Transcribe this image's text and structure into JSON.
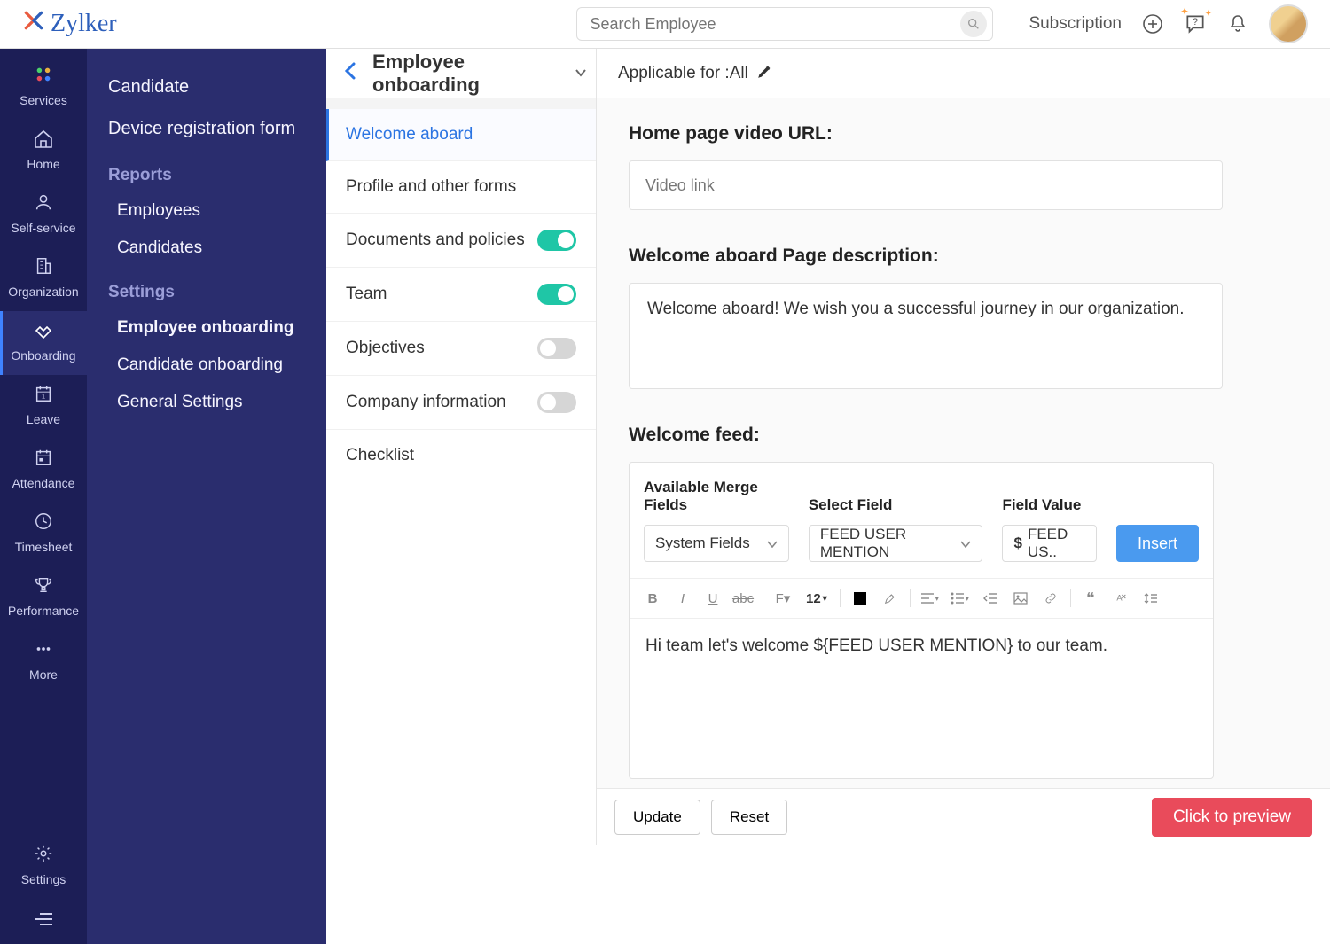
{
  "brand": {
    "name": "Zylker"
  },
  "header": {
    "search_placeholder": "Search Employee",
    "subscription": "Subscription"
  },
  "rail": {
    "items": [
      {
        "label": "Services",
        "icon": "grid"
      },
      {
        "label": "Home",
        "icon": "home"
      },
      {
        "label": "Self-service",
        "icon": "person"
      },
      {
        "label": "Organization",
        "icon": "building"
      },
      {
        "label": "Onboarding",
        "icon": "handshake",
        "active": true
      },
      {
        "label": "Leave",
        "icon": "calendar"
      },
      {
        "label": "Attendance",
        "icon": "calendar-range"
      },
      {
        "label": "Timesheet",
        "icon": "clock"
      },
      {
        "label": "Performance",
        "icon": "trophy"
      },
      {
        "label": "More",
        "icon": "dots"
      }
    ],
    "bottom": [
      {
        "label": "Settings",
        "icon": "gear"
      },
      {
        "label": "",
        "icon": "menu"
      }
    ]
  },
  "subnav": {
    "top_links": [
      "Candidate",
      "Device registration form"
    ],
    "sections": [
      {
        "heading": "Reports",
        "links": [
          "Employees",
          "Candidates"
        ]
      },
      {
        "heading": "Settings",
        "links": [
          "Employee onboarding",
          "Candidate onboarding",
          "General Settings"
        ],
        "active_index": 0
      }
    ]
  },
  "page": {
    "title": "Employee onboarding",
    "applicable_label": "Applicable for :",
    "applicable_value": "All"
  },
  "steps": [
    {
      "label": "Welcome aboard",
      "toggle": null,
      "active": true
    },
    {
      "label": "Profile and other forms",
      "toggle": null
    },
    {
      "label": "Documents and policies",
      "toggle": true
    },
    {
      "label": "Team",
      "toggle": true
    },
    {
      "label": "Objectives",
      "toggle": false
    },
    {
      "label": "Company information",
      "toggle": false
    },
    {
      "label": "Checklist",
      "toggle": null
    }
  ],
  "content": {
    "video_label": "Home page video URL:",
    "video_placeholder": "Video link",
    "desc_label": "Welcome aboard Page description:",
    "desc_value": "Welcome aboard! We wish you a successful journey in our organization.",
    "feed_label": "Welcome feed:",
    "merge": {
      "available_label": "Available Merge Fields",
      "available_value": "System Fields",
      "select_label": "Select Field",
      "select_value": "FEED USER MENTION",
      "fieldvalue_label": "Field Value",
      "fieldvalue_value": "FEED US..",
      "insert": "Insert"
    },
    "toolbar": {
      "font_size": "12"
    },
    "editor_value": "Hi team let's welcome ${FEED USER MENTION} to our team."
  },
  "footer": {
    "update": "Update",
    "reset": "Reset",
    "preview": "Click to preview"
  }
}
